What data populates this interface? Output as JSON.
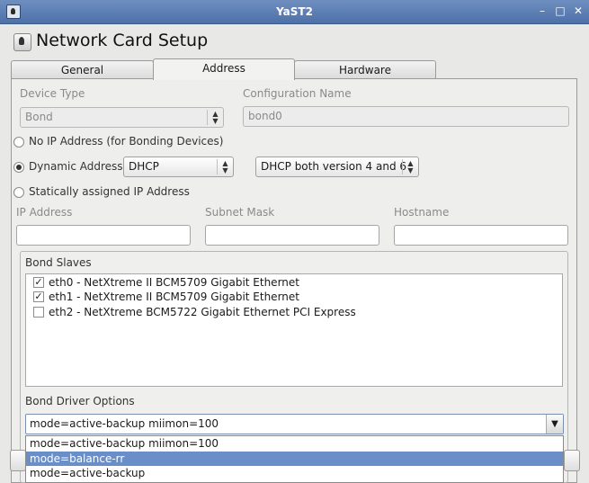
{
  "window": {
    "title": "YaST2",
    "minimize_glyph": "–",
    "maximize_glyph": "□",
    "close_glyph": "✕"
  },
  "heading": "Network Card Setup",
  "tabs": [
    {
      "label": "General",
      "active": false
    },
    {
      "label": "Address",
      "active": true
    },
    {
      "label": "Hardware",
      "active": false
    }
  ],
  "device_type": {
    "label": "Device Type",
    "value": "Bond"
  },
  "configuration_name": {
    "label": "Configuration Name",
    "value": "bond0"
  },
  "addressing": {
    "no_ip_label": "No IP Address (for Bonding Devices)",
    "dynamic_label": "Dynamic Address",
    "dynamic_mode": "DHCP",
    "dhcp_version": "DHCP both version 4 and 6",
    "static_label": "Statically assigned IP Address",
    "selected": "dynamic"
  },
  "static_fields": {
    "ip_label": "IP Address",
    "ip_value": "",
    "mask_label": "Subnet Mask",
    "mask_value": "",
    "hostname_label": "Hostname",
    "hostname_value": ""
  },
  "bond_slaves": {
    "label": "Bond Slaves",
    "items": [
      {
        "label": "eth0 - NetXtreme II BCM5709 Gigabit Ethernet",
        "checked": true
      },
      {
        "label": "eth1 - NetXtreme II BCM5709 Gigabit Ethernet",
        "checked": true
      },
      {
        "label": "eth2 - NetXtreme BCM5722 Gigabit Ethernet PCI Express",
        "checked": false
      }
    ]
  },
  "bond_driver_options": {
    "label": "Bond Driver Options",
    "value": "mode=active-backup miimon=100",
    "dropdown_items": [
      "mode=active-backup miimon=100",
      "mode=balance-rr",
      "mode=active-backup"
    ],
    "highlighted_index": 1
  },
  "colors": {
    "titlebar": "#5a7bb2",
    "selection": "#6a8ec7"
  }
}
